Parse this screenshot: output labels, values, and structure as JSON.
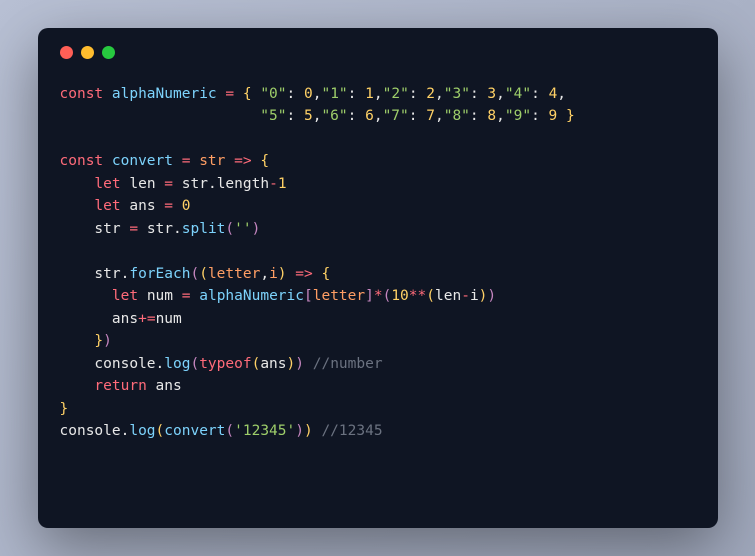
{
  "window": {
    "lights": [
      "red",
      "yellow",
      "green"
    ]
  },
  "code": {
    "t": {
      "const": "const",
      "alphaNumeric": "alphaNumeric",
      "eq": "=",
      "lbrace": "{",
      "rbrace": "}",
      "k0": "\"0\"",
      "v0": "0",
      "k1": "\"1\"",
      "v1": "1",
      "k2": "\"2\"",
      "v2": "2",
      "k3": "\"3\"",
      "v3": "3",
      "k4": "\"4\"",
      "v4": "4",
      "k5": "\"5\"",
      "v5": "5",
      "k6": "\"6\"",
      "v6": "6",
      "k7": "\"7\"",
      "v7": "7",
      "k8": "\"8\"",
      "v8": "8",
      "k9": "\"9\"",
      "v9": "9",
      "colon": ":",
      "comma": ",",
      "convert": "convert",
      "str": "str",
      "arrow": "=>",
      "let": "let",
      "len": "len",
      "length": "length",
      "minus": "-",
      "one": "1",
      "ans": "ans",
      "zero": "0",
      "dot": ".",
      "split": "split",
      "lparen": "(",
      "rparen": ")",
      "empty": "''",
      "forEach": "forEach",
      "letter": "letter",
      "i": "i",
      "num": "num",
      "lbracket": "[",
      "rbracket": "]",
      "star": "*",
      "ten": "10",
      "dblstar": "**",
      "pluseq": "+=",
      "console": "console",
      "log": "log",
      "typeof": "typeof",
      "comment1": "//number",
      "return": "return",
      "s12345": "'12345'",
      "comment2": "//12345"
    }
  }
}
